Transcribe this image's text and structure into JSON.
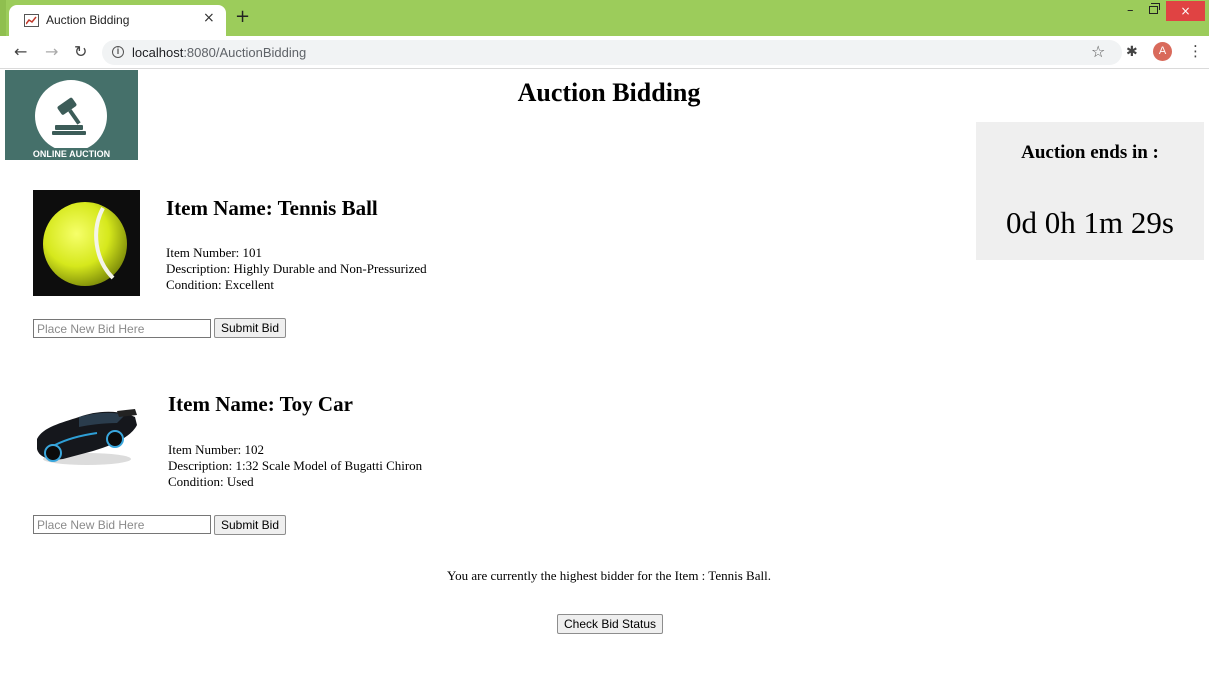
{
  "browser": {
    "tab_title": "Auction Bidding",
    "tab_close": "×",
    "new_tab": "+",
    "url_host": "localhost",
    "url_path": ":8080/AuctionBidding",
    "avatar_letter": "A",
    "window_min": "–",
    "window_close": "×",
    "icons": [
      "back-icon",
      "forward-icon",
      "reload-icon",
      "info-icon",
      "star-icon",
      "extensions-icon",
      "menu-icon"
    ]
  },
  "logo": {
    "text": "ONLINE AUCTION"
  },
  "page": {
    "title": "Auction Bidding"
  },
  "timer": {
    "label": "Auction ends in :",
    "value": "0d 0h 1m 29s"
  },
  "items": [
    {
      "name": "Item Name: Tennis Ball",
      "number": "Item Number: 101",
      "description": "Description: Highly Durable and Non-Pressurized",
      "condition": "Condition: Excellent",
      "bid_placeholder": "Place New Bid Here",
      "submit_label": "Submit Bid"
    },
    {
      "name": "Item Name: Toy Car",
      "number": "Item Number: 102",
      "description": "Description: 1:32 Scale Model of Bugatti Chiron",
      "condition": "Condition: Used",
      "bid_placeholder": "Place New Bid Here",
      "submit_label": "Submit Bid"
    }
  ],
  "status": {
    "message": "You are currently the highest bidder for the Item : Tennis Ball.",
    "check_label": "Check Bid Status"
  },
  "colors": {
    "tabbar": "#9ccc5b",
    "logo_bg": "#45706a",
    "timer_bg": "#efefef",
    "close_button": "#e04343"
  }
}
